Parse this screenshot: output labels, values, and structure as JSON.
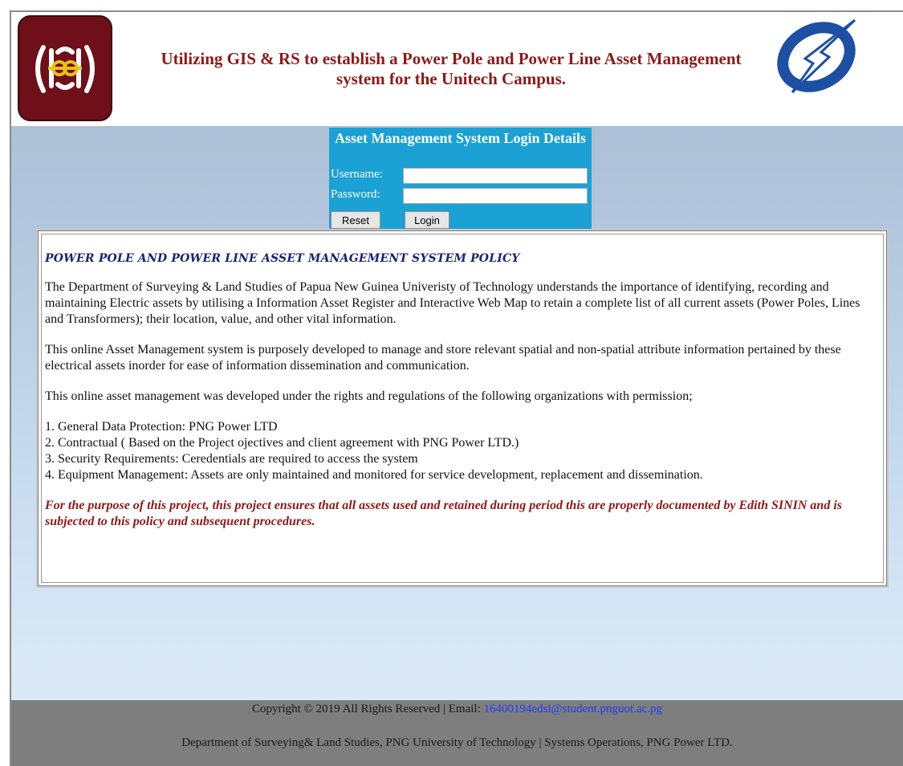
{
  "header": {
    "title": "Utilizing GIS & RS to establish a Power Pole and Power Line Asset Management system for the Unitech Campus."
  },
  "login": {
    "title": "Asset Management System Login Details",
    "username_label": "Username:",
    "password_label": "Password:",
    "username_value": "",
    "password_value": "",
    "reset_label": "Reset",
    "login_label": "Login"
  },
  "policy": {
    "title": "POWER POLE AND POWER LINE ASSET MANAGEMENT SYSTEM POLICY",
    "paragraphs": [
      "The Department of Surveying & Land Studies of Papua New Guinea Univeristy of Technology understands the importance of identifying, recording and maintaining Electric assets by utilising a Information Asset Register and Interactive Web Map to retain a complete list of all current assets (Power Poles, Lines and Transformers); their location, value, and other vital information.",
      "This online Asset Management system is purposely developed to manage and store relevant spatial and non-spatial attribute information pertained by these electrical assets inorder for ease of information dissemination and communication.",
      "This online asset management was developed under the rights and regulations of the following organizations with permission;"
    ],
    "list": [
      "1. General Data Protection: PNG Power LTD",
      "2. Contractual ( Based on the Project ojectives and client agreement with PNG Power LTD.)",
      "3. Security Requirements: Ceredentials are required to access the system",
      "4. Equipment Management: Assets are only maintained and monitored for service development, replacement and dissemination."
    ],
    "note": "For the purpose of this project, this project ensures that all assets used and retained during period this are properly documented by Edith SININ and is subjected to this policy and subsequent procedures."
  },
  "footer": {
    "copyright": "Copyright © 2019 All Rights Reserved | Email: ",
    "email": "16400194edsi@student.pnguot.ac.pg",
    "line2": "Department of Surveying& Land Studies, PNG University of Technology | Systems Operations, PNG Power LTD."
  },
  "colors": {
    "title_red": "#8b1a1a",
    "login_blue": "#1ba1d4",
    "policy_title_navy": "#1a2470",
    "footer_gray": "#7e7e7e",
    "link_blue": "#1c3cff"
  },
  "icons": {
    "left_logo": "university-logo",
    "right_logo": "power-company-logo"
  }
}
